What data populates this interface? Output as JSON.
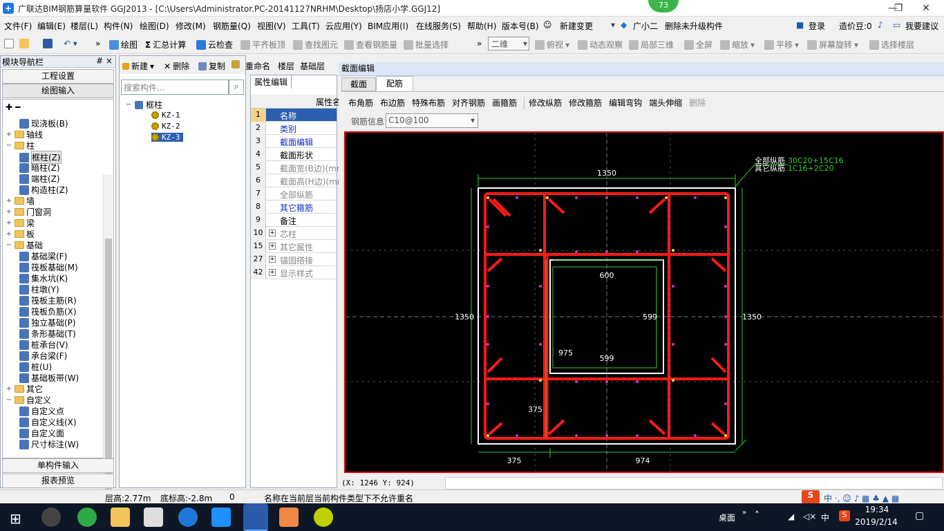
{
  "titlebar": {
    "title": "广联达BIM钢筋算量软件 GGJ2013 - [C:\\Users\\Administrator.PC-20141127NRHM\\Desktop\\扬店小学.GGJ12]",
    "badge": "73",
    "minimize": "—",
    "maximize": "❐",
    "close": "✕"
  },
  "menu": {
    "items": [
      "文件(F)",
      "编辑(E)",
      "楼层(L)",
      "构件(N)",
      "绘图(D)",
      "修改(M)",
      "钢筋量(Q)",
      "视图(V)",
      "工具(T)",
      "云应用(Y)",
      "BIM应用(I)",
      "在线服务(S)",
      "帮助(H)",
      "版本号(B)",
      "新建变更",
      "广小二",
      "删除未升级构件"
    ],
    "right": {
      "login": "登录",
      "price_beans": "造价豆:0",
      "suggest": "我要建议"
    }
  },
  "toolbar": {
    "draw": "绘图",
    "sum": "汇总计算",
    "cloud_check": "云检查",
    "align_top": "平齐板顶",
    "find_elem": "查找图元",
    "view_rebar": "查看钢筋量",
    "batch_select": "批量选择",
    "view_mode": "二维",
    "top_view": "俯视",
    "dyn_observe": "动态观察",
    "local_3d": "局部三维",
    "fullscreen": "全屏",
    "zoom": "缩放",
    "pan": "平移",
    "rotate": "屏幕旋转",
    "select_floor": "选择楼层"
  },
  "nav": {
    "header": "模块导航栏",
    "header_pin": "# ×",
    "project_settings": "工程设置",
    "draw_input": "绘图输入",
    "tree": [
      {
        "label": "现浇板(B)",
        "level": 2,
        "type": "leaf"
      },
      {
        "label": "轴线",
        "level": 1,
        "type": "folder",
        "exp": "+"
      },
      {
        "label": "柱",
        "level": 1,
        "type": "folder",
        "exp": "−"
      },
      {
        "label": "框柱(Z)",
        "level": 2,
        "type": "leaf",
        "selected": true
      },
      {
        "label": "暗柱(Z)",
        "level": 2,
        "type": "leaf"
      },
      {
        "label": "端柱(Z)",
        "level": 2,
        "type": "leaf"
      },
      {
        "label": "构造柱(Z)",
        "level": 2,
        "type": "leaf"
      },
      {
        "label": "墙",
        "level": 1,
        "type": "folder",
        "exp": "+"
      },
      {
        "label": "门窗洞",
        "level": 1,
        "type": "folder",
        "exp": "+"
      },
      {
        "label": "梁",
        "level": 1,
        "type": "folder",
        "exp": "+"
      },
      {
        "label": "板",
        "level": 1,
        "type": "folder",
        "exp": "+"
      },
      {
        "label": "基础",
        "level": 1,
        "type": "folder",
        "exp": "−"
      },
      {
        "label": "基础梁(F)",
        "level": 2,
        "type": "leaf"
      },
      {
        "label": "筏板基础(M)",
        "level": 2,
        "type": "leaf"
      },
      {
        "label": "集水坑(K)",
        "level": 2,
        "type": "leaf"
      },
      {
        "label": "柱墩(Y)",
        "level": 2,
        "type": "leaf"
      },
      {
        "label": "筏板主筋(R)",
        "level": 2,
        "type": "leaf"
      },
      {
        "label": "筏板负筋(X)",
        "level": 2,
        "type": "leaf"
      },
      {
        "label": "独立基础(P)",
        "level": 2,
        "type": "leaf"
      },
      {
        "label": "条形基础(T)",
        "level": 2,
        "type": "leaf"
      },
      {
        "label": "桩承台(V)",
        "level": 2,
        "type": "leaf"
      },
      {
        "label": "承台梁(F)",
        "level": 2,
        "type": "leaf"
      },
      {
        "label": "桩(U)",
        "level": 2,
        "type": "leaf"
      },
      {
        "label": "基础板带(W)",
        "level": 2,
        "type": "leaf"
      },
      {
        "label": "其它",
        "level": 1,
        "type": "folder",
        "exp": "+"
      },
      {
        "label": "自定义",
        "level": 1,
        "type": "folder",
        "exp": "−"
      },
      {
        "label": "自定义点",
        "level": 2,
        "type": "leaf"
      },
      {
        "label": "自定义线(X)",
        "level": 2,
        "type": "leaf"
      },
      {
        "label": "自定义面",
        "level": 2,
        "type": "leaf"
      },
      {
        "label": "尺寸标注(W)",
        "level": 2,
        "type": "leaf"
      }
    ],
    "single_input": "单构件输入",
    "report": "报表预览"
  },
  "components": {
    "new": "新建",
    "delete": "删除",
    "copy": "复制",
    "rename": "重命名",
    "floor": "楼层",
    "base_floor": "基础层",
    "search_placeholder": "搜索构件...",
    "root": "框柱",
    "items": [
      "KZ-1",
      "KZ-2",
      "KZ-3"
    ]
  },
  "properties": {
    "tab": "属性编辑",
    "header": "属性名",
    "rows": [
      {
        "num": "1",
        "label": "名称",
        "style": "selected"
      },
      {
        "num": "2",
        "label": "类别",
        "style": "blue"
      },
      {
        "num": "3",
        "label": "截面编辑",
        "style": "blue"
      },
      {
        "num": "4",
        "label": "截面形状",
        "style": "black"
      },
      {
        "num": "5",
        "label": "截面宽(B边)(mm)",
        "style": "gray"
      },
      {
        "num": "6",
        "label": "截面高(H边)(mm)",
        "style": "gray"
      },
      {
        "num": "7",
        "label": "全部纵筋",
        "style": "gray"
      },
      {
        "num": "8",
        "label": "其它箍筋",
        "style": "blue"
      },
      {
        "num": "9",
        "label": "备注",
        "style": "black"
      },
      {
        "num": "10",
        "label": "芯柱",
        "style": "gray",
        "plus": true
      },
      {
        "num": "15",
        "label": "其它属性",
        "style": "gray",
        "plus": true
      },
      {
        "num": "27",
        "label": "锚固搭接",
        "style": "gray",
        "plus": true
      },
      {
        "num": "42",
        "label": "显示样式",
        "style": "gray",
        "plus": true
      }
    ]
  },
  "section_editor": {
    "title": "截面编辑",
    "tabs": [
      "截面",
      "配筋"
    ],
    "tools": [
      "布角筋",
      "布边筋",
      "特殊布筋",
      "对齐钢筋",
      "画箍筋",
      "修改纵筋",
      "修改箍筋",
      "编辑弯钩",
      "端头伸缩",
      "删除"
    ],
    "rebar_info_label": "钢筋信息",
    "rebar_info_value": "C10@100",
    "drawing": {
      "all_long_label": "全部纵筋",
      "all_long_value": "30C20+15C16",
      "other_rebar_label": "其它纵筋",
      "other_rebar_value": "1C16+2C20",
      "dims": {
        "top": "1350",
        "left": "1350",
        "right": "1350",
        "inner_top": "600",
        "inner_right": "599",
        "inner_bottom": "599",
        "inner_left": "975",
        "lower_left": "375",
        "bottom_left": "375",
        "bottom_right": "974"
      }
    },
    "coord": "(X: 1246 Y: 924)"
  },
  "status": {
    "floor_height": "层高:2.77m",
    "base_height": "底标高:-2.8m",
    "zero": "0",
    "message": "名称在当前层当前构件类型下不允许重名"
  },
  "taskbar": {
    "desktop": "桌面",
    "ime": "中",
    "time": "19:34",
    "date": "2019/2/14"
  },
  "colors": {
    "canvas_bg": "#000000",
    "rebar": "#ff1a1a",
    "dim": "#33cc33",
    "stirrup_point": "#cc33cc",
    "outline": "#ffffff"
  }
}
